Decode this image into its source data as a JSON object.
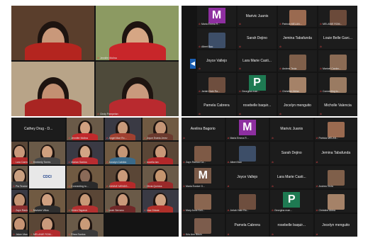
{
  "screenshots": {
    "top_left": {
      "tiles": [
        {
          "name": "",
          "kind": "video",
          "skin": "#c9987a",
          "shirt": "#b4251f",
          "bg": "#5a3e2c"
        },
        {
          "name": "Jennifer Molina",
          "kind": "video",
          "skin": "#d6a684",
          "shirt": "#c8262a",
          "bg": "#8c9a62"
        },
        {
          "name": "",
          "kind": "video",
          "skin": "#c39072",
          "shirt": "#a92523",
          "bg": "#b8a488"
        },
        {
          "name": "Cindy Pampelan",
          "kind": "video",
          "skin": "#c99a7d",
          "shirt": "#b92a2f",
          "bg": "#4e4a3a"
        }
      ]
    },
    "top_right": {
      "rows": [
        [
          {
            "name": "Maria Emma R...",
            "label": "M",
            "letter_color": "#8e2fa0"
          },
          {
            "name": "Marivic Juanis",
            "label": ""
          },
          {
            "name": "Patricia MELAN...",
            "label": "",
            "thumb": "#9a6a50"
          },
          {
            "name": "MELANIE ROM...",
            "label": "",
            "thumb": "#6b4a3a"
          }
        ],
        [
          {
            "name": "Albert Bao",
            "label": "",
            "thumb": "#3d4e68"
          },
          {
            "name": "Sarah Dejino",
            "label": ""
          },
          {
            "name": "Jemina Tabafunda",
            "label": ""
          },
          {
            "name": "Louie Belle Garc...",
            "label": ""
          }
        ],
        [
          {
            "name": "Joyce Vallejo",
            "label": ""
          },
          {
            "name": "Lara Marie Casti...",
            "label": ""
          },
          {
            "name": "Andrea Tecla",
            "label": "",
            "thumb": "#7f5f4a"
          },
          {
            "name": "Maricel Carder...",
            "label": "",
            "thumb": "#8b6b54"
          }
        ],
        [
          {
            "name": "Jerlah Hale Ra...",
            "label": "",
            "thumb": "#6e4e3e"
          },
          {
            "name": "Georgina mae...",
            "label": "P",
            "letter_color": "#1e7a52"
          },
          {
            "name": "Christine Abina",
            "label": "",
            "thumb": "#a58268"
          },
          {
            "name": "Connecting to...",
            "label": "",
            "thumb": "#9a7b62"
          }
        ],
        [
          {
            "name": "Pamela Cabrera",
            "label": ""
          },
          {
            "name": "rosebelle baquir...",
            "label": ""
          },
          {
            "name": "Jocelyn menguito",
            "label": ""
          },
          {
            "name": "Micholle Valencia",
            "label": ""
          }
        ]
      ]
    },
    "bottom_left": {
      "tiles": [
        {
          "name": "Cathey Drug - D...",
          "kind": "name"
        },
        {
          "name": "Jennifer Molina",
          "kind": "video",
          "skin": "#d0a080",
          "shirt": "#c02a2c"
        },
        {
          "name": "Angel Mae Ro...",
          "kind": "video",
          "skin": "#c89a7a",
          "shirt": "#a04030"
        },
        {
          "name": "Joyce Estela Jerez",
          "kind": "video",
          "skin": "#c49576",
          "shirt": "#6b3a2e"
        },
        {
          "name": "Lara Carmen C...",
          "kind": "video",
          "skin": "#c8987a",
          "shirt": "#b02a2a"
        },
        {
          "name": "Kimberly Torres",
          "kind": "video",
          "skin": "#cf9f7e",
          "shirt": "#454545"
        },
        {
          "name": "Marian Santos",
          "kind": "video",
          "skin": "#d2a585",
          "shirt": "#b92c30"
        },
        {
          "name": "Jonalyn Cabildo",
          "kind": "video",
          "skin": "#c59676",
          "shirt": "#3a6a8a"
        },
        {
          "name": "novella tan",
          "kind": "video",
          "skin": "#c99878",
          "shirt": "#b2282a"
        },
        {
          "name": "Pia Teodorico",
          "kind": "video",
          "skin": "#caa080",
          "shirt": "#3c3c3c"
        },
        {
          "name": "CDCI",
          "kind": "logo"
        },
        {
          "name": "Connecting to...",
          "kind": "video",
          "skin": "#8a6a58",
          "shirt": "#2a2a2a"
        },
        {
          "name": "JANINE MENDS...",
          "kind": "video",
          "skin": "#c99a7a",
          "shirt": "#b52a2a"
        },
        {
          "name": "Olivia Quintos",
          "kind": "video",
          "skin": "#c4956f",
          "shirt": "#9a2a2a"
        },
        {
          "name": "Zayn Ranica Ca...",
          "kind": "video",
          "skin": "#c29272",
          "shirt": "#8a3030"
        },
        {
          "name": "Marivee Villos",
          "kind": "video",
          "skin": "#d0a080",
          "shirt": "#2e2e2e"
        },
        {
          "name": "Vivien Tagaruk",
          "kind": "video",
          "skin": "#c89876",
          "shirt": "#b43030"
        },
        {
          "name": "Leah Serrano",
          "kind": "video",
          "skin": "#c9987a",
          "shirt": "#702828"
        },
        {
          "name": "Lisa Orlane",
          "kind": "video",
          "skin": "#cfa282",
          "shirt": "#b0302a"
        },
        {
          "name": "Jeken Manalo",
          "kind": "video",
          "skin": "#c69474",
          "shirt": "#303030"
        },
        {
          "name": "MELANIE ROM...",
          "kind": "video",
          "skin": "#c89a7c",
          "shirt": "#b22a2c"
        },
        {
          "name": "Rhea Santos",
          "kind": "video",
          "skin": "#c99a78",
          "shirt": "#3a3a3a"
        }
      ]
    },
    "bottom_right": {
      "rows": [
        [
          {
            "name": "Avelina Bagorio",
            "label": ""
          },
          {
            "name": "Maria Emma R...",
            "label": "M",
            "letter_color": "#8e2fa0"
          },
          {
            "name": "Marivic Juanis",
            "label": ""
          },
          {
            "name": "Patricia MELAN...",
            "label": "",
            "thumb": "#9a6a50"
          }
        ],
        [
          {
            "name": "Zayn Ranica Ca...",
            "label": "",
            "thumb": "#7e5a46"
          },
          {
            "name": "Albert Bao",
            "label": "",
            "thumb": "#3d4e68"
          },
          {
            "name": "Sarah Dejino",
            "label": ""
          },
          {
            "name": "Jemina Tabafunda",
            "label": ""
          }
        ],
        [
          {
            "name": "Maria Eunice G...",
            "label": "M",
            "letter_color": "#7a5a48"
          },
          {
            "name": "Joyce Vallejo",
            "label": ""
          },
          {
            "name": "Lara Marie Casti...",
            "label": ""
          },
          {
            "name": "Andrea Tecla",
            "label": "",
            "thumb": "#7f5f4a"
          }
        ],
        [
          {
            "name": "Mary Anne Kell...",
            "label": "",
            "thumb": "#8a6650"
          },
          {
            "name": "Jerlah Hale Ra...",
            "label": "",
            "thumb": "#6e4e3e"
          },
          {
            "name": "Georgina mae...",
            "label": "P",
            "letter_color": "#1e7a52"
          },
          {
            "name": "Christine Abina",
            "label": "",
            "thumb": "#a58268"
          }
        ],
        [
          {
            "name": "Kris Ann Bituin",
            "label": "",
            "thumb": "#7c5c4c"
          },
          {
            "name": "Pamela Cabrera",
            "label": ""
          },
          {
            "name": "rosebelle baquir...",
            "label": ""
          },
          {
            "name": "Jocelyn menguito",
            "label": ""
          }
        ]
      ]
    },
    "nav_arrow": "◀"
  }
}
